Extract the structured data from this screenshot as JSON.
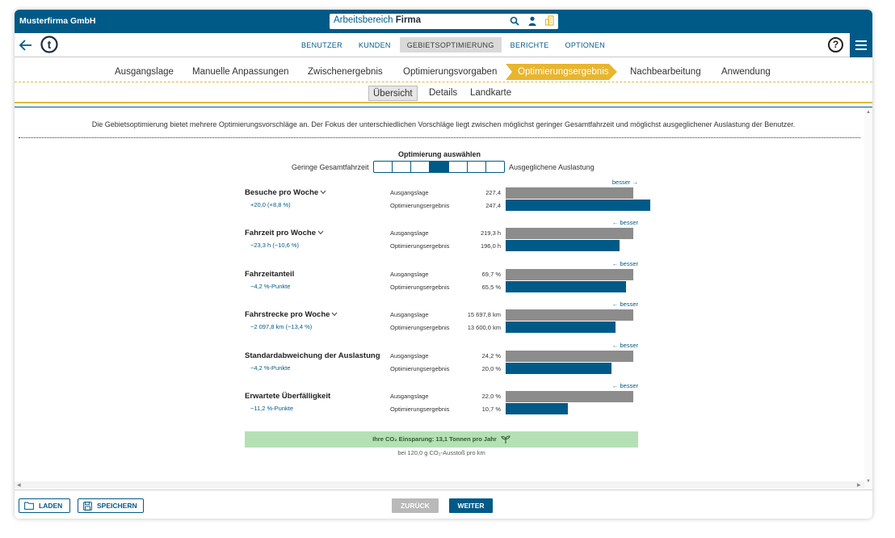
{
  "header": {
    "company": "Musterfirma GmbH",
    "workspace_prefix": "Arbeitsbereich",
    "workspace_name": "Firma"
  },
  "nav": {
    "items": [
      {
        "label": "BENUTZER",
        "active": false
      },
      {
        "label": "KUNDEN",
        "active": false
      },
      {
        "label": "GEBIETSOPTIMIERUNG",
        "active": true
      },
      {
        "label": "BERICHTE",
        "active": false
      },
      {
        "label": "OPTIONEN",
        "active": false
      }
    ],
    "help_label": "?"
  },
  "steps": {
    "items": [
      "Ausgangslage",
      "Manuelle Anpassungen",
      "Zwischenergebnis",
      "Optimierungsvorgaben",
      "Optimierungsergebnis",
      "Nachbearbeitung",
      "Anwendung"
    ],
    "active": "Optimierungsergebnis"
  },
  "subtabs": {
    "items": [
      "Übersicht",
      "Details",
      "Landkarte"
    ],
    "active": "Übersicht"
  },
  "intro": "Die Gebietsoptimierung bietet mehrere Optimierungsvorschläge an. Der Fokus der unterschiedlichen Vorschläge liegt zwischen möglichst geringer Gesamtfahrzeit und möglichst ausgeglichener Auslastung der Benutzer.",
  "slider": {
    "title": "Optimierung auswählen",
    "left_label": "Geringe Gesamtfahrzeit",
    "right_label": "Ausgeglichene Auslastung",
    "segments": 7,
    "selected_index": 3
  },
  "row_labels": {
    "base": "Ausgangslage",
    "opt": "Optimierungsergebnis"
  },
  "metrics": [
    {
      "name": "Besuche pro Woche",
      "chevron": true,
      "delta": "+20,0 (+8,8 %)",
      "base_value": "227,4",
      "opt_value": "247,4",
      "base_fraction": 0.88,
      "opt_fraction": 1.0,
      "better": "besser →"
    },
    {
      "name": "Fahrzeit pro Woche",
      "chevron": true,
      "delta": "−23,3 h (−10,6 %)",
      "base_value": "219,3 h",
      "opt_value": "196,0 h",
      "base_fraction": 0.88,
      "opt_fraction": 0.79,
      "better": "← besser"
    },
    {
      "name": "Fahrzeitanteil",
      "chevron": false,
      "delta": "−4,2 %-Punkte",
      "base_value": "69,7 %",
      "opt_value": "65,5 %",
      "base_fraction": 0.88,
      "opt_fraction": 0.83,
      "better": "← besser"
    },
    {
      "name": "Fahrstrecke pro Woche",
      "chevron": true,
      "delta": "−2 097,8 km (−13,4 %)",
      "base_value": "15 697,8 km",
      "opt_value": "13 600,0 km",
      "base_fraction": 0.88,
      "opt_fraction": 0.76,
      "better": "← besser"
    },
    {
      "name": "Standardabweichung der Auslastung",
      "chevron": false,
      "delta": "−4,2 %-Punkte",
      "base_value": "24,2 %",
      "opt_value": "20,0 %",
      "base_fraction": 0.88,
      "opt_fraction": 0.73,
      "better": "← besser"
    },
    {
      "name": "Erwartete Überfälligkeit",
      "chevron": false,
      "delta": "−11,2 %-Punkte",
      "base_value": "22,0 %",
      "opt_value": "10,7 %",
      "base_fraction": 0.88,
      "opt_fraction": 0.43,
      "better": "← besser"
    }
  ],
  "co2": {
    "text": "Ihre CO₂ Einsparung: 13,1 Tonnen pro Jahr",
    "subtext": "bei 120,0 g CO₂-Ausstoß pro km"
  },
  "footer": {
    "load_label": "LADEN",
    "save_label": "SPEICHERN",
    "back_label": "ZURÜCK",
    "next_label": "WEITER"
  },
  "colors": {
    "primary": "#005a87",
    "base_bar": "#8c8c8c",
    "step_active": "#e8b52e",
    "co2_bg": "#b5e0b5"
  }
}
